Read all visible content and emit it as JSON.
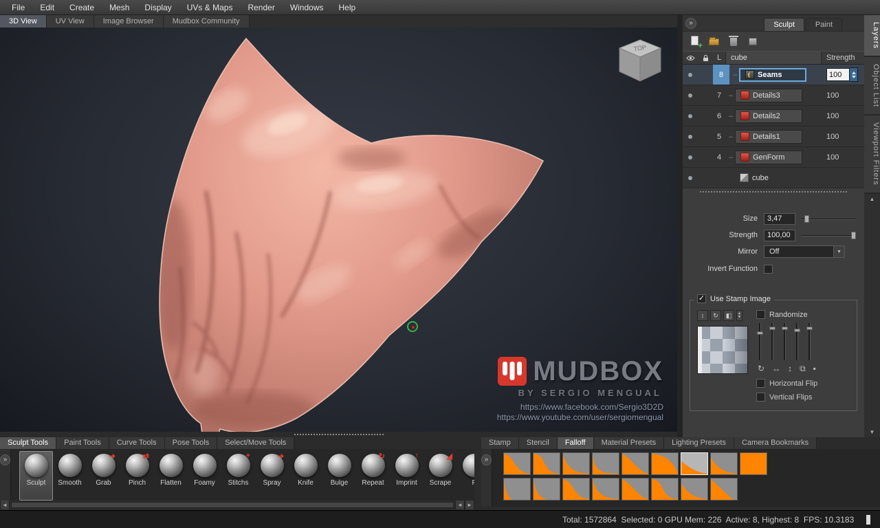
{
  "colors": {
    "falloff_orange": "#ff8400",
    "selection_blue": "#5d92c0",
    "logo_red": "#d6382c"
  },
  "menubar": {
    "items": [
      "File",
      "Edit",
      "Create",
      "Mesh",
      "Display",
      "UVs & Maps",
      "Render",
      "Windows",
      "Help"
    ]
  },
  "view_tabs": [
    {
      "label": "3D View",
      "selected": true
    },
    {
      "label": "UV View"
    },
    {
      "label": "Image Browser"
    },
    {
      "label": "Mudbox Community"
    }
  ],
  "viewport": {
    "viewcube_top_label": "TOP",
    "watermark": {
      "title": "MUDBOX",
      "subtitle": "BY SERGIO MENGUAL",
      "link_facebook": "https://www.facebook.com/Sergio3D2D",
      "link_youtube": "https://www.youtube.com/user/sergiomengual"
    }
  },
  "right_panel": {
    "mode_tabs": [
      {
        "label": "Sculpt",
        "selected": true
      },
      {
        "label": "Paint"
      }
    ],
    "layer_table": {
      "header_level": "L",
      "header_name": "cube",
      "header_strength": "Strength",
      "layers": [
        {
          "level": "8",
          "name": "Seams",
          "strength": "100",
          "icon": "seam",
          "selected": true
        },
        {
          "level": "7",
          "name": "Details3",
          "strength": "100",
          "icon": "sculpt"
        },
        {
          "level": "6",
          "name": "Details2",
          "strength": "100",
          "icon": "sculpt"
        },
        {
          "level": "5",
          "name": "Details1",
          "strength": "100",
          "icon": "sculpt"
        },
        {
          "level": "4",
          "name": "GenForm",
          "strength": "100",
          "icon": "sculpt"
        },
        {
          "name": "cube",
          "icon": "cube",
          "is_root": true
        }
      ]
    },
    "properties": {
      "size_label": "Size",
      "size_value": "3,47",
      "strength_label": "Strength",
      "strength_value": "100,00",
      "mirror_label": "Mirror",
      "mirror_value": "Off",
      "invert_label": "Invert Function",
      "use_stamp_label": "Use Stamp Image",
      "randomize_label": "Randomize",
      "horizontal_flip_label": "Horizontal Flip",
      "vertical_flip_label": "Vertical Flips"
    }
  },
  "side_tabs": [
    {
      "label": "Layers",
      "selected": true
    },
    {
      "label": "Object List"
    },
    {
      "label": "Viewport Filters"
    }
  ],
  "tool_tabs": [
    {
      "label": "Sculpt Tools",
      "selected": true
    },
    {
      "label": "Paint Tools"
    },
    {
      "label": "Curve Tools"
    },
    {
      "label": "Pose Tools"
    },
    {
      "label": "Select/Move Tools"
    }
  ],
  "tools": [
    {
      "label": "Sculpt",
      "selected": true
    },
    {
      "label": "Smooth"
    },
    {
      "label": "Grab",
      "accent": "➔"
    },
    {
      "label": "Pinch",
      "accent": "⇄"
    },
    {
      "label": "Flatten"
    },
    {
      "label": "Foamy"
    },
    {
      "label": "Stitchs",
      "accent": "+"
    },
    {
      "label": "Spray",
      "accent": "➔"
    },
    {
      "label": "Knife"
    },
    {
      "label": "Bulge"
    },
    {
      "label": "Repeat",
      "accent": "↻"
    },
    {
      "label": "Imprint",
      "accent": "↑"
    },
    {
      "label": "Scrape",
      "accent": "◢"
    },
    {
      "label": "F"
    }
  ],
  "preset_tabs": [
    {
      "label": "Stamp"
    },
    {
      "label": "Stencil"
    },
    {
      "label": "Falloff",
      "selected": true
    },
    {
      "label": "Material Presets"
    },
    {
      "label": "Lighting Presets"
    },
    {
      "label": "Camera Bookmarks"
    }
  ],
  "falloffs": {
    "row1": [
      {
        "shape": "s1"
      },
      {
        "shape": "s2"
      },
      {
        "shape": "ease1"
      },
      {
        "shape": "ease2"
      },
      {
        "shape": "mid"
      },
      {
        "shape": "dome"
      },
      {
        "shape": "shallow",
        "selected": true
      },
      {
        "shape": "shallow2"
      },
      {
        "shape": "solid"
      }
    ],
    "row2": [
      {
        "shape": "spike"
      },
      {
        "shape": "steep"
      },
      {
        "shape": "s1"
      },
      {
        "shape": "ease1"
      },
      {
        "shape": "mid"
      },
      {
        "shape": "s2"
      },
      {
        "shape": "shallow2"
      },
      {
        "shape": "tri"
      }
    ]
  },
  "statusbar": {
    "text": "Total: 1572864  Selected: 0 GPU Mem: 226  Active: 8, Highest: 8  FPS: 10.3183"
  }
}
